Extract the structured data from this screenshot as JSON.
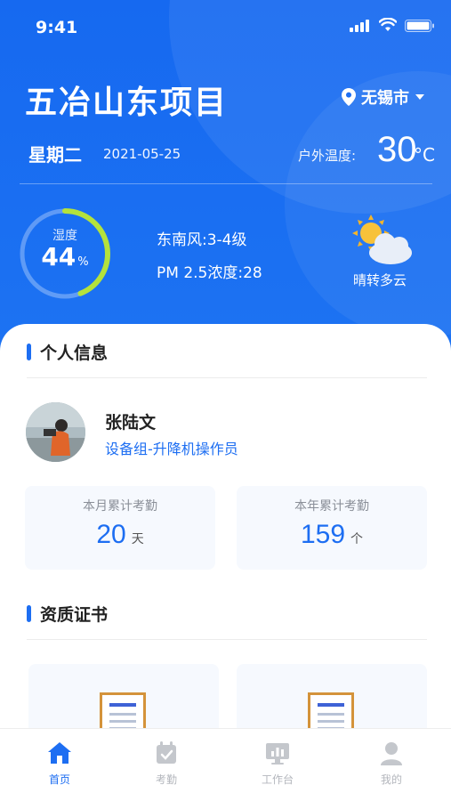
{
  "status_bar": {
    "time": "9:41"
  },
  "header": {
    "project_title": "五冶山东项目",
    "city": "无锡市",
    "weekday": "星期二",
    "date": "2021-05-25",
    "temp_label": "户外温度:",
    "temp_value": "30",
    "temp_unit": "°C"
  },
  "weather": {
    "humidity_label": "湿度",
    "humidity_value": "44",
    "humidity_unit": "%",
    "humidity_fraction": 0.44,
    "wind": "东南风:3-4级",
    "pm25": "PM 2.5浓度:28",
    "condition": "晴转多云"
  },
  "personal": {
    "section_title": "个人信息",
    "name": "张陆文",
    "role": "设备组-升降机操作员"
  },
  "attendance": {
    "month_label": "本月累计考勤",
    "month_value": "20",
    "month_unit": "天",
    "year_label": "本年累计考勤",
    "year_value": "159",
    "year_unit": "个"
  },
  "certificates": {
    "section_title": "资质证书"
  },
  "tabbar": {
    "items": [
      {
        "label": "首页",
        "icon": "home-icon",
        "active": true
      },
      {
        "label": "考勤",
        "icon": "calendar-icon",
        "active": false
      },
      {
        "label": "工作台",
        "icon": "dashboard-icon",
        "active": false
      },
      {
        "label": "我的",
        "icon": "user-icon",
        "active": false
      }
    ]
  },
  "colors": {
    "primary": "#1d6ef2",
    "ring_accent": "#b4e23c",
    "cert_border": "#d4933a"
  }
}
